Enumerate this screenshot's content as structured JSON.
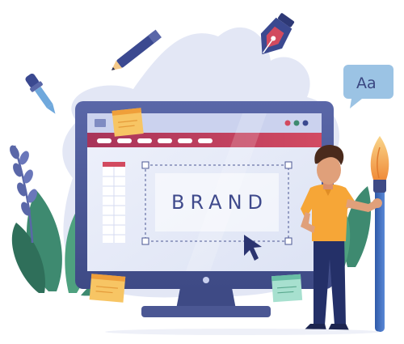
{
  "illustration": {
    "brand_text": "BRAND",
    "speech_bubble_text": "Aa",
    "colors": {
      "monitor_frame": "#4b5793",
      "screen": "#e6eaf8",
      "title_bar": "#c23a5b",
      "accent_orange": "#f4a94a",
      "sticky_note": "#f7c564",
      "sticky_note_green": "#a7e0cf",
      "leaves": "#3d8a6f",
      "blob": "#e2e6f5",
      "character_shirt": "#f6a637",
      "character_pants": "#243068",
      "brush_handle": "#3f68b3"
    },
    "icons": [
      "pencil-icon",
      "pen-nib-icon",
      "eyedropper-icon",
      "speech-bubble-icon",
      "paintbrush-icon",
      "cursor-arrow-icon"
    ]
  }
}
